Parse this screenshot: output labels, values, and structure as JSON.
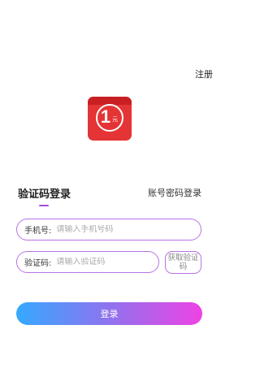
{
  "header": {
    "register_label": "注册"
  },
  "logo": {
    "number": "1",
    "unit": "元"
  },
  "tabs": {
    "code_login": "验证码登录",
    "password_login": "账号密码登录"
  },
  "form": {
    "phone": {
      "label": "手机号:",
      "placeholder": "请输入手机号码",
      "value": ""
    },
    "code": {
      "label": "验证码:",
      "placeholder": "请输入验证码",
      "value": ""
    },
    "get_code_label": "获取验证码"
  },
  "login_button": {
    "label": "登录"
  },
  "colors": {
    "accent": "#b872e8",
    "logo_red": "#e53435",
    "gradient_start": "#35a9ff",
    "gradient_end": "#ee43e4"
  }
}
